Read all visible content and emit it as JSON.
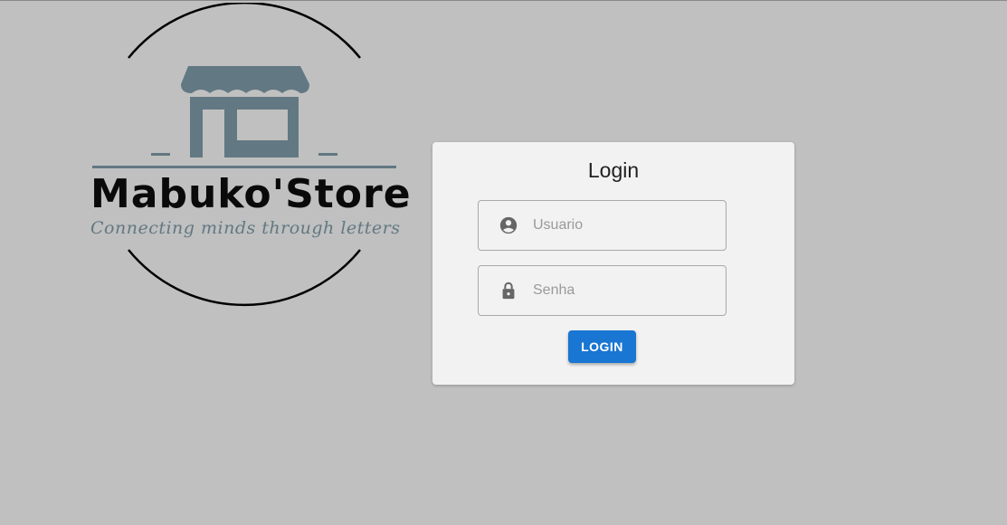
{
  "logo": {
    "name": "Mabuko'Store",
    "tagline": "Connecting minds through letters",
    "icon": "store-icon",
    "color": "#627882"
  },
  "login": {
    "title": "Login",
    "username": {
      "placeholder": "Usuario",
      "value": "",
      "icon": "account-circle-icon"
    },
    "password": {
      "placeholder": "Senha",
      "value": "",
      "icon": "lock-icon"
    },
    "button_label": "LOGIN",
    "button_color": "#1976d2"
  }
}
